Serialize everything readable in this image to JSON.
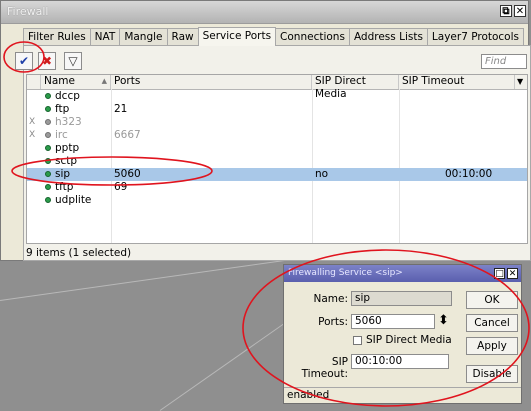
{
  "window": {
    "title": "Firewall",
    "restore_icon": "⧉",
    "close_icon": "✕"
  },
  "tabs": [
    {
      "label": "Filter Rules"
    },
    {
      "label": "NAT"
    },
    {
      "label": "Mangle"
    },
    {
      "label": "Raw"
    },
    {
      "label": "Service Ports"
    },
    {
      "label": "Connections"
    },
    {
      "label": "Address Lists"
    },
    {
      "label": "Layer7 Protocols"
    }
  ],
  "toolbar": {
    "enable_icon": "✔",
    "disable_icon": "✖",
    "filter_icon": "▽",
    "find_placeholder": "Find"
  },
  "columns": {
    "name": "Name",
    "ports": "Ports",
    "sip_direct_media": "SIP Direct Media",
    "sip_timeout": "SIP Timeout",
    "sort_icon": "▲",
    "menu_icon": "▼"
  },
  "rows": [
    {
      "flag": "",
      "name": "dccp",
      "ports": "",
      "enabled": true,
      "sip_direct_media": "",
      "sip_timeout": ""
    },
    {
      "flag": "",
      "name": "ftp",
      "ports": "21",
      "enabled": true,
      "sip_direct_media": "",
      "sip_timeout": ""
    },
    {
      "flag": "X",
      "name": "h323",
      "ports": "",
      "enabled": false,
      "sip_direct_media": "",
      "sip_timeout": ""
    },
    {
      "flag": "X",
      "name": "irc",
      "ports": "6667",
      "enabled": false,
      "sip_direct_media": "",
      "sip_timeout": ""
    },
    {
      "flag": "",
      "name": "pptp",
      "ports": "",
      "enabled": true,
      "sip_direct_media": "",
      "sip_timeout": ""
    },
    {
      "flag": "",
      "name": "sctp",
      "ports": "",
      "enabled": true,
      "sip_direct_media": "",
      "sip_timeout": ""
    },
    {
      "flag": "",
      "name": "sip",
      "ports": "5060",
      "enabled": true,
      "sip_direct_media": "no",
      "sip_timeout": "00:10:00"
    },
    {
      "flag": "",
      "name": "tftp",
      "ports": "69",
      "enabled": true,
      "sip_direct_media": "",
      "sip_timeout": ""
    },
    {
      "flag": "",
      "name": "udplite",
      "ports": "",
      "enabled": true,
      "sip_direct_media": "",
      "sip_timeout": ""
    }
  ],
  "status_text": "9 items (1 selected)",
  "dialog": {
    "title": "Firewalling Service <sip>",
    "restore_icon": "□",
    "close_icon": "✕",
    "name_label": "Name:",
    "name_value": "sip",
    "ports_label": "Ports:",
    "ports_value": "5060",
    "ports_spinner_icon": "⬍",
    "direct_media_label": "SIP Direct Media",
    "direct_media_checked": false,
    "timeout_label": "SIP Timeout:",
    "timeout_value": "00:10:00",
    "ok_label": "OK",
    "cancel_label": "Cancel",
    "apply_label": "Apply",
    "disable_label": "Disable",
    "status": "enabled"
  },
  "colors": {
    "selection": "#a9c8e8",
    "annotation": "#e0141e",
    "dialog_title": "#5a5fae"
  }
}
